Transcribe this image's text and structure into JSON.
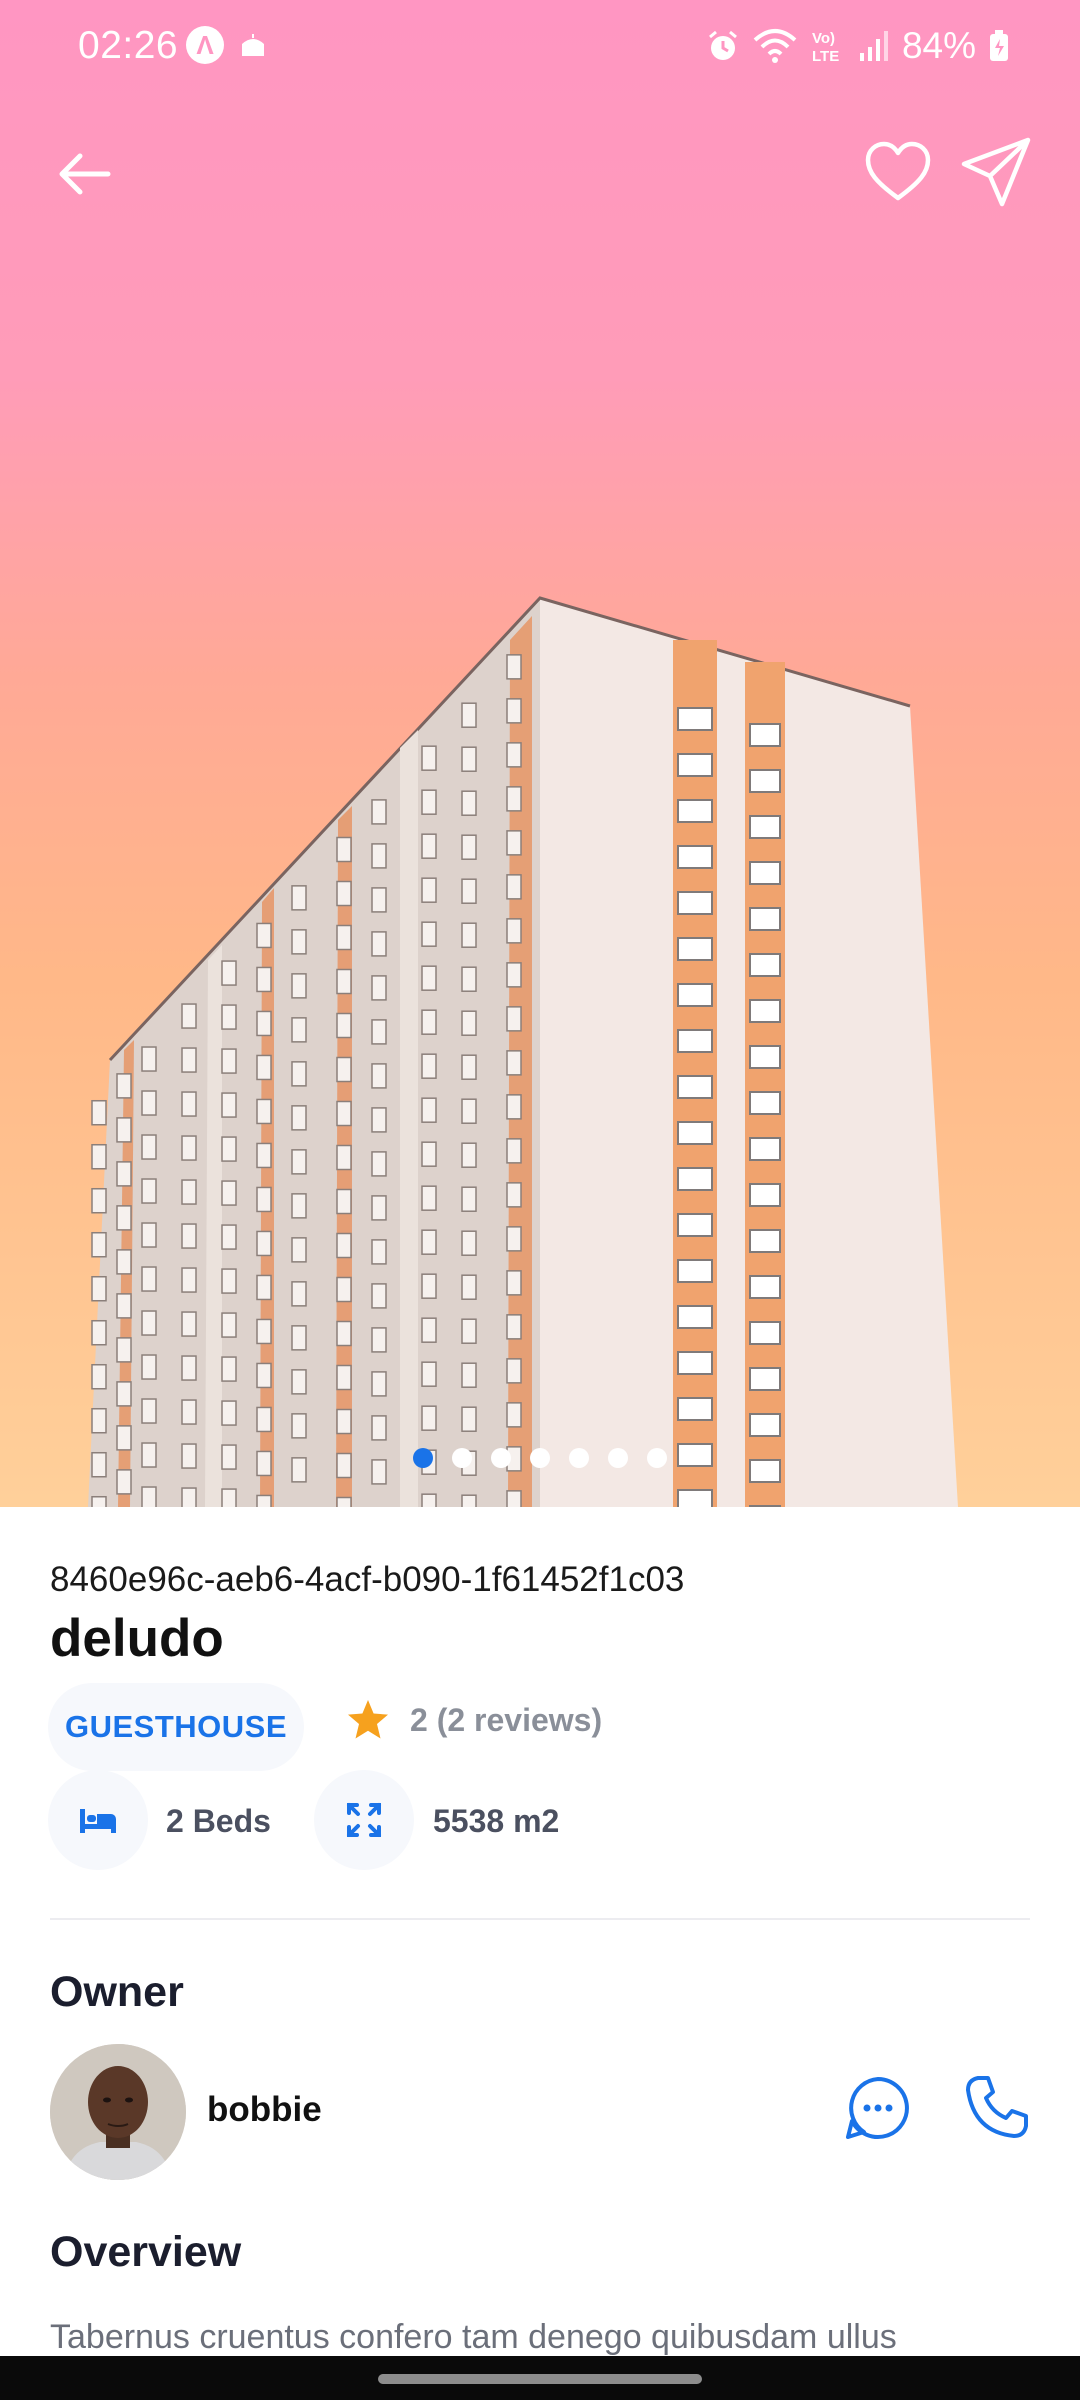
{
  "status_bar": {
    "time": "02:26",
    "battery_percent": "84%"
  },
  "hero": {
    "image_count": 7,
    "active_image_index": 0,
    "colors": {
      "sky_top": "#ff96c2",
      "sky_bottom": "#ffd09a",
      "building_face": "#f3e6e2",
      "accent_panel": "#f0a36e"
    }
  },
  "listing": {
    "id": "8460e96c-aeb6-4acf-b090-1f61452f1c03",
    "title": "deludo",
    "type_label": "GUESTHOUSE",
    "rating_text": "2 (2 reviews)",
    "beds_label": "2 Beds",
    "area_label": "5538 m2"
  },
  "owner": {
    "section_title": "Owner",
    "name": "bobbie"
  },
  "overview": {
    "section_title": "Overview",
    "text": "Tabernus cruentus confero tam denego quibusdam ullus"
  },
  "colors": {
    "accent": "#1a73e8",
    "star": "#f6a11e",
    "muted_text": "#8a8f99"
  }
}
